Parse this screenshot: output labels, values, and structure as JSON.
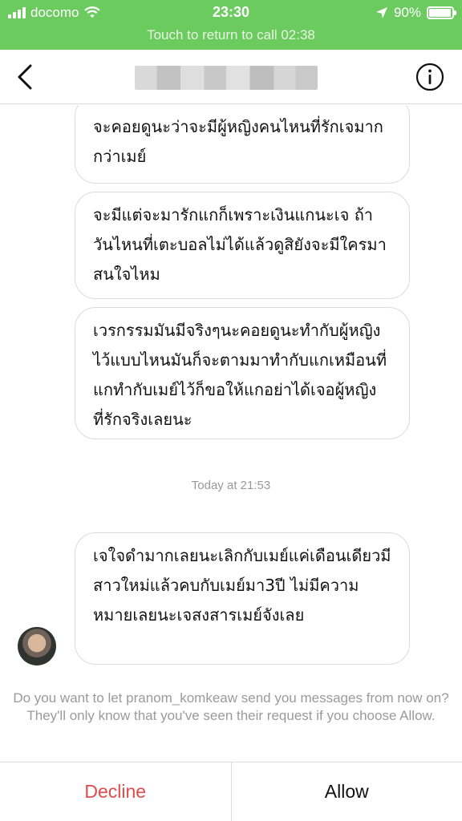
{
  "status_bar": {
    "carrier": "docomo",
    "time": "23:30",
    "battery": "90%",
    "battery_level": 0.9,
    "call_banner": "Touch to return to call 02:38",
    "icons": [
      "signal-icon",
      "wifi-icon",
      "location-arrow-icon",
      "battery-icon"
    ],
    "background_color": "#6ccb5f"
  },
  "header": {
    "icons": [
      "chevron-left-icon",
      "info-icon"
    ]
  },
  "messages": [
    {
      "text": "จะคอยดูนะว่าจะมีผู้หญิงคนไหนที่รักเจมากกว่าเมย์"
    },
    {
      "text": "จะมีแต่จะมารักแกก็เพราะเงินแกนะเจ ถ้าวันไหนที่เตะบอลไม่ได้แล้วดูสิยังจะมีใครมาสนใจไหม"
    },
    {
      "text": "เวรกรรมมันมีจริงๆนะคอยดูนะทำกับผู้หญิงไว้แบบไหนมันก็จะตามมาทำกับแกเหมือนที่แกทำกับเมย์ไว้ก็ขอให้แกอย่าได้เจอผู้หญิงที่รักจริงเลยนะ"
    },
    {
      "text": "เจใจดำมากเลยนะเลิกกับเมย์แค่เดือนเดียวมีสาวใหม่แล้วคบกับเมย์มา3ปี ไม่มีความหมายเลยนะเจสงสารเมย์จังเลย"
    }
  ],
  "timestamp": "Today at 21:53",
  "request": {
    "prompt": "Do you want to let pranom_komkeaw send you messages from now on? They'll only know that you've seen their request if you choose Allow.",
    "decline_label": "Decline",
    "allow_label": "Allow",
    "decline_color": "#e04b4b"
  }
}
